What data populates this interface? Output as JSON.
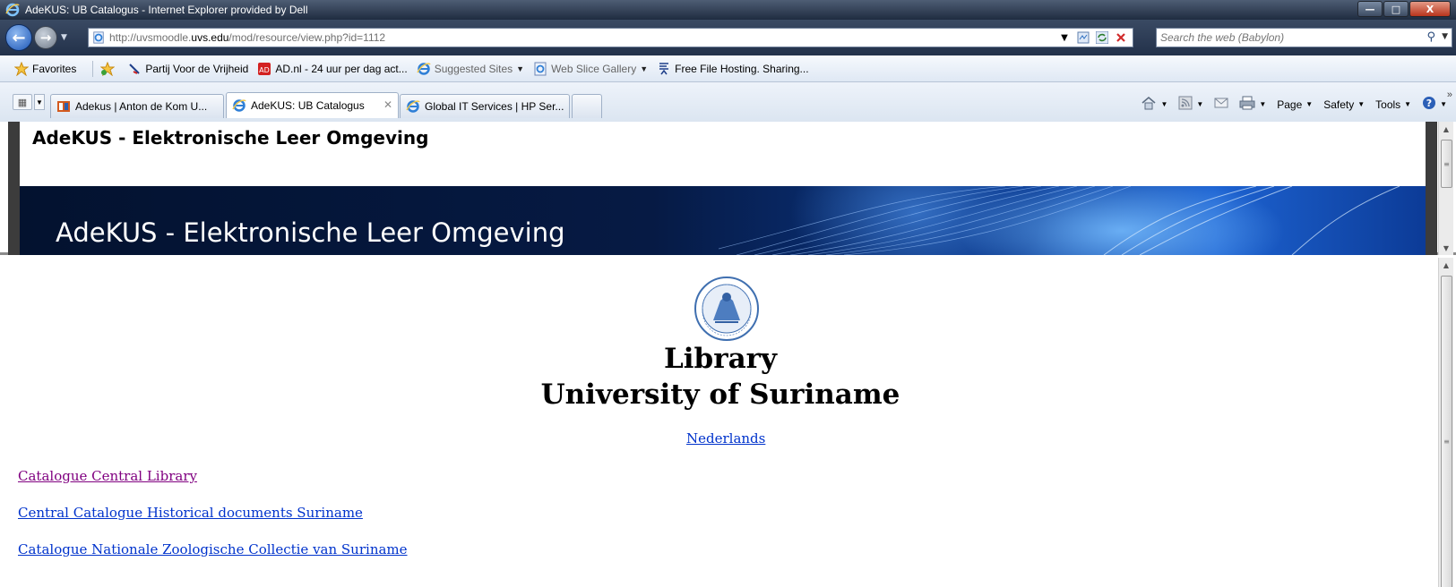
{
  "window": {
    "title": "AdeKUS: UB Catalogus - Internet Explorer provided by Dell",
    "min_label": "—",
    "max_label": "□",
    "close_label": "X"
  },
  "address": {
    "url_prefix": "http://uvsmoodle.",
    "url_domain": "uvs.edu",
    "url_suffix": "/mod/resource/view.php?id=1112"
  },
  "search": {
    "placeholder": "Search the web (Babylon)"
  },
  "favorites_bar": {
    "favorites_label": "Favorites",
    "items": [
      {
        "label": "Partij Voor de Vrijheid",
        "icon": "pvv-icon"
      },
      {
        "label": "AD.nl - 24 uur per dag act...",
        "icon": "ad-icon"
      },
      {
        "label": "Suggested Sites",
        "icon": "ie-icon"
      },
      {
        "label": "Web Slice Gallery",
        "icon": "webslice-icon"
      },
      {
        "label": "Free File Hosting. Sharing...",
        "icon": "filehost-icon"
      }
    ]
  },
  "tabs": [
    {
      "label": "Adekus | Anton de Kom U..."
    },
    {
      "label": "AdeKUS: UB Catalogus"
    },
    {
      "label": "Global IT Services | HP Ser..."
    }
  ],
  "command_bar": {
    "page": "Page",
    "safety": "Safety",
    "tools": "Tools",
    "more": "»"
  },
  "top_frame": {
    "heading": "AdeKUS - Elektronische Leer Omgeving",
    "banner_title": "AdeKUS - Elektronische Leer Omgeving"
  },
  "main": {
    "title_line1": "Library",
    "title_line2": "University of Suriname",
    "language_link": "Nederlands",
    "links": [
      "Catalogue Central Library",
      "Central Catalogue Historical documents Suriname",
      "Catalogue Nationale Zoologische Collectie van Suriname"
    ]
  },
  "colors": {
    "link": "#0033cc",
    "visited_link": "#800080",
    "banner_dark": "#03122f",
    "banner_light": "#1d63d2"
  }
}
